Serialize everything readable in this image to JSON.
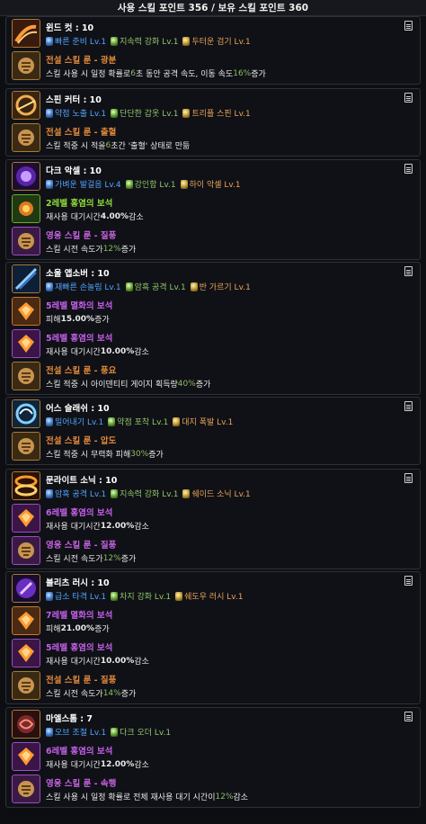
{
  "header": {
    "title": "사용 스킬 포인트 356 / 보유 스킬 포인트 360"
  },
  "colors": {
    "tripod_blue": "#4fa4ff",
    "tripod_green": "#8fc56a",
    "tripod_orange": "#e8a35a",
    "rune_orange": "#e0893a",
    "gem_purple": "#c25fe8"
  },
  "skills": [
    {
      "name": "윈드 컷 : 10",
      "icon": "wind-cut-icon",
      "tripods": [
        {
          "label": "빠른 준비 Lv.1",
          "tier": "blue"
        },
        {
          "label": "지속력 강화 Lv.1",
          "tier": "green"
        },
        {
          "label": "두터운 검기 Lv.1",
          "tier": "orange"
        }
      ],
      "details": [
        {
          "kind": "rune",
          "title": "전설 스킬 룬 - 광분",
          "desc_pre": "스킬 사용 시 일정 확률로 ",
          "desc_hl": "6",
          "desc_mid": "초 동안 공격 속도, 이동 속도 ",
          "desc_hl2": "16%",
          "desc_post": " 증가"
        }
      ]
    },
    {
      "name": "스핀 커터 : 10",
      "icon": "spin-cutter-icon",
      "tripods": [
        {
          "label": "약점 노출 Lv.1",
          "tier": "blue"
        },
        {
          "label": "단단한 갑옷 Lv.1",
          "tier": "green"
        },
        {
          "label": "트리플 스핀 Lv.1",
          "tier": "orange"
        }
      ],
      "details": [
        {
          "kind": "rune",
          "title": "전설 스킬 룬 - 출혈",
          "desc_pre": "스킬 적중 시 적을 ",
          "desc_hl": "6",
          "desc_mid": "초간 '출혈' 상태로 만듦",
          "desc_hl2": "",
          "desc_post": ""
        }
      ]
    },
    {
      "name": "다크 악셀 : 10",
      "icon": "dark-axel-icon",
      "tripods": [
        {
          "label": "가벼운 발걸음 Lv.4",
          "tier": "blue"
        },
        {
          "label": "강인함 Lv.1",
          "tier": "green"
        },
        {
          "label": "하이 악셀 Lv.1",
          "tier": "orange"
        }
      ],
      "details": [
        {
          "kind": "gem-green",
          "title": "2레벨 홍염의 보석",
          "desc_pre": "재사용 대기시간 ",
          "desc_hl": "4.00%",
          "desc_mid": " 감소",
          "desc_hl2": "",
          "desc_post": ""
        },
        {
          "kind": "rune-purple",
          "title": "영웅 스킬 룬 - 질풍",
          "desc_pre": "스킬 시전 속도가 ",
          "desc_hl": "12%",
          "desc_mid": " 증가",
          "desc_hl2": "",
          "desc_post": ""
        }
      ]
    },
    {
      "name": "소울 앱소버 : 10",
      "icon": "soul-absorber-icon",
      "tripods": [
        {
          "label": "재빠른 손놀림 Lv.1",
          "tier": "blue"
        },
        {
          "label": "암흑 공격 Lv.1",
          "tier": "green"
        },
        {
          "label": "반 가르기 Lv.1",
          "tier": "orange"
        }
      ],
      "details": [
        {
          "kind": "gem-orange",
          "title": "5레벨 멸화의 보석",
          "desc_pre": "피해 ",
          "desc_hl": "15.00%",
          "desc_mid": " 증가",
          "desc_hl2": "",
          "desc_post": ""
        },
        {
          "kind": "gem-purple",
          "title": "5레벨 홍염의 보석",
          "desc_pre": "재사용 대기시간 ",
          "desc_hl": "10.00%",
          "desc_mid": " 감소",
          "desc_hl2": "",
          "desc_post": ""
        },
        {
          "kind": "rune",
          "title": "전설 스킬 룬 - 풍요",
          "desc_pre": "스킬 적중 시 아이덴티티 게이지 획득량 ",
          "desc_hl": "40%",
          "desc_mid": " 증가",
          "desc_hl2": "",
          "desc_post": ""
        }
      ]
    },
    {
      "name": "어스 슬래쉬 : 10",
      "icon": "earth-slash-icon",
      "tripods": [
        {
          "label": "밀어내기 Lv.1",
          "tier": "blue"
        },
        {
          "label": "약점 포착 Lv.1",
          "tier": "green"
        },
        {
          "label": "대지 폭발 Lv.1",
          "tier": "orange"
        }
      ],
      "details": [
        {
          "kind": "rune",
          "title": "전설 스킬 룬 - 압도",
          "desc_pre": "스킬 적중 시 무력화 피해 ",
          "desc_hl": "30%",
          "desc_mid": " 증가",
          "desc_hl2": "",
          "desc_post": ""
        }
      ]
    },
    {
      "name": "문라이트 소닉 : 10",
      "icon": "moonlight-sonic-icon",
      "tripods": [
        {
          "label": "암흑 공격 Lv.1",
          "tier": "blue"
        },
        {
          "label": "지속력 강화 Lv.1",
          "tier": "green"
        },
        {
          "label": "쉐이드 소닉 Lv.1",
          "tier": "orange"
        }
      ],
      "details": [
        {
          "kind": "gem-purple",
          "title": "6레벨 홍염의 보석",
          "desc_pre": "재사용 대기시간 ",
          "desc_hl": "12.00%",
          "desc_mid": " 감소",
          "desc_hl2": "",
          "desc_post": ""
        },
        {
          "kind": "rune-purple",
          "title": "영웅 스킬 룬 - 질풍",
          "desc_pre": "스킬 시전 속도가 ",
          "desc_hl": "12%",
          "desc_mid": " 증가",
          "desc_hl2": "",
          "desc_post": ""
        }
      ]
    },
    {
      "name": "블리츠 러시 : 10",
      "icon": "blitz-rush-icon",
      "tripods": [
        {
          "label": "급소 타격 Lv.1",
          "tier": "blue"
        },
        {
          "label": "차지 강화 Lv.1",
          "tier": "green"
        },
        {
          "label": "쉐도우 러시 Lv.1",
          "tier": "orange"
        }
      ],
      "details": [
        {
          "kind": "gem-orange",
          "title": "7레벨 멸화의 보석",
          "desc_pre": "피해 ",
          "desc_hl": "21.00%",
          "desc_mid": " 증가",
          "desc_hl2": "",
          "desc_post": ""
        },
        {
          "kind": "gem-purple",
          "title": "5레벨 홍염의 보석",
          "desc_pre": "재사용 대기시간 ",
          "desc_hl": "10.00%",
          "desc_mid": " 감소",
          "desc_hl2": "",
          "desc_post": ""
        },
        {
          "kind": "rune",
          "title": "전설 스킬 룬 - 질풍",
          "desc_pre": "스킬 시전 속도가 ",
          "desc_hl": "14%",
          "desc_mid": " 증가",
          "desc_hl2": "",
          "desc_post": ""
        }
      ]
    },
    {
      "name": "마엘스톰 : 7",
      "icon": "maelstrom-icon",
      "tripods": [
        {
          "label": "오브 조절 Lv.1",
          "tier": "blue"
        },
        {
          "label": "다크 오더 Lv.1",
          "tier": "green"
        }
      ],
      "details": [
        {
          "kind": "gem-purple",
          "title": "6레벨 홍염의 보석",
          "desc_pre": "재사용 대기시간 ",
          "desc_hl": "12.00%",
          "desc_mid": " 감소",
          "desc_hl2": "",
          "desc_post": ""
        },
        {
          "kind": "rune-purple",
          "title": "영웅 스킬 룬 - 속행",
          "desc_pre": "스킬 사용 시 일정 확률로 전체 재사용 대기 시간이 ",
          "desc_hl": "12%",
          "desc_mid": " 감소",
          "desc_hl2": "",
          "desc_post": ""
        }
      ]
    }
  ]
}
